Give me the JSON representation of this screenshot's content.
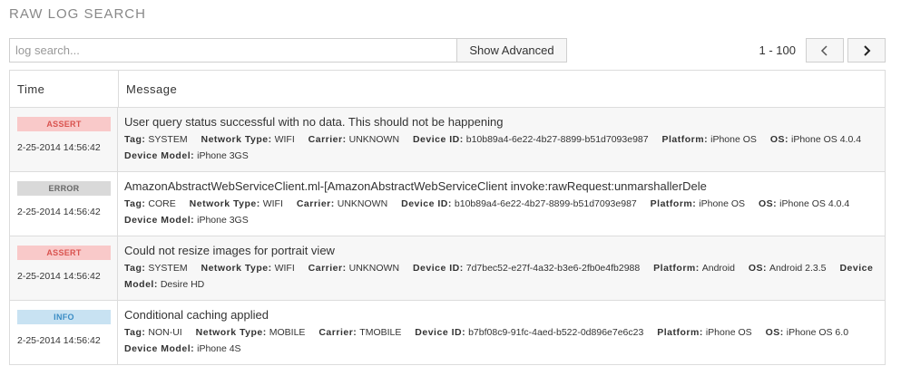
{
  "page": {
    "title": "RAW LOG SEARCH"
  },
  "search": {
    "placeholder": "log search...",
    "value": ""
  },
  "toolbar": {
    "show_advanced_label": "Show Advanced"
  },
  "pager": {
    "range": "1 - 100",
    "prev_icon": "chevron-left-icon",
    "next_icon": "chevron-right-icon"
  },
  "table": {
    "headers": {
      "time": "Time",
      "message": "Message"
    },
    "labels": {
      "tag": "Tag:",
      "network": "Network Type:",
      "carrier": "Carrier:",
      "device_id": "Device ID:",
      "platform": "Platform:",
      "os": "OS:",
      "device_model": "Device Model:"
    },
    "rows": [
      {
        "level": "ASSERT",
        "time": "2-25-2014 14:56:42",
        "message": "User query status successful with no data. This should not be happening",
        "tag": "SYSTEM",
        "network": "WIFI",
        "carrier": "UNKNOWN",
        "device_id": "b10b89a4-6e22-4b27-8899-b51d7093e987",
        "platform": "iPhone OS",
        "os": "iPhone OS 4.0.4",
        "device_model": "iPhone 3GS"
      },
      {
        "level": "ERROR",
        "time": "2-25-2014 14:56:42",
        "message": "AmazonAbstractWebServiceClient.ml-[AmazonAbstractWebServiceClient invoke:rawRequest:unmarshallerDele",
        "tag": "CORE",
        "network": "WIFI",
        "carrier": "UNKNOWN",
        "device_id": "b10b89a4-6e22-4b27-8899-b51d7093e987",
        "platform": "iPhone OS",
        "os": "iPhone OS 4.0.4",
        "device_model": "iPhone 3GS"
      },
      {
        "level": "ASSERT",
        "time": "2-25-2014 14:56:42",
        "message": "Could not resize images for portrait view",
        "tag": "SYSTEM",
        "network": "WIFI",
        "carrier": "UNKNOWN",
        "device_id": "7d7bec52-e27f-4a32-b3e6-2fb0e4fb2988",
        "platform": "Android",
        "os": "Android 2.3.5",
        "device_model": "Desire HD"
      },
      {
        "level": "INFO",
        "time": "2-25-2014 14:56:42",
        "message": "Conditional caching applied",
        "tag": "NON-UI",
        "network": "MOBILE",
        "carrier": "TMOBILE",
        "device_id": "b7bf08c9-91fc-4aed-b522-0d896e7e6c23",
        "platform": "iPhone OS",
        "os": "iPhone OS 6.0",
        "device_model": "iPhone 4S"
      }
    ]
  }
}
